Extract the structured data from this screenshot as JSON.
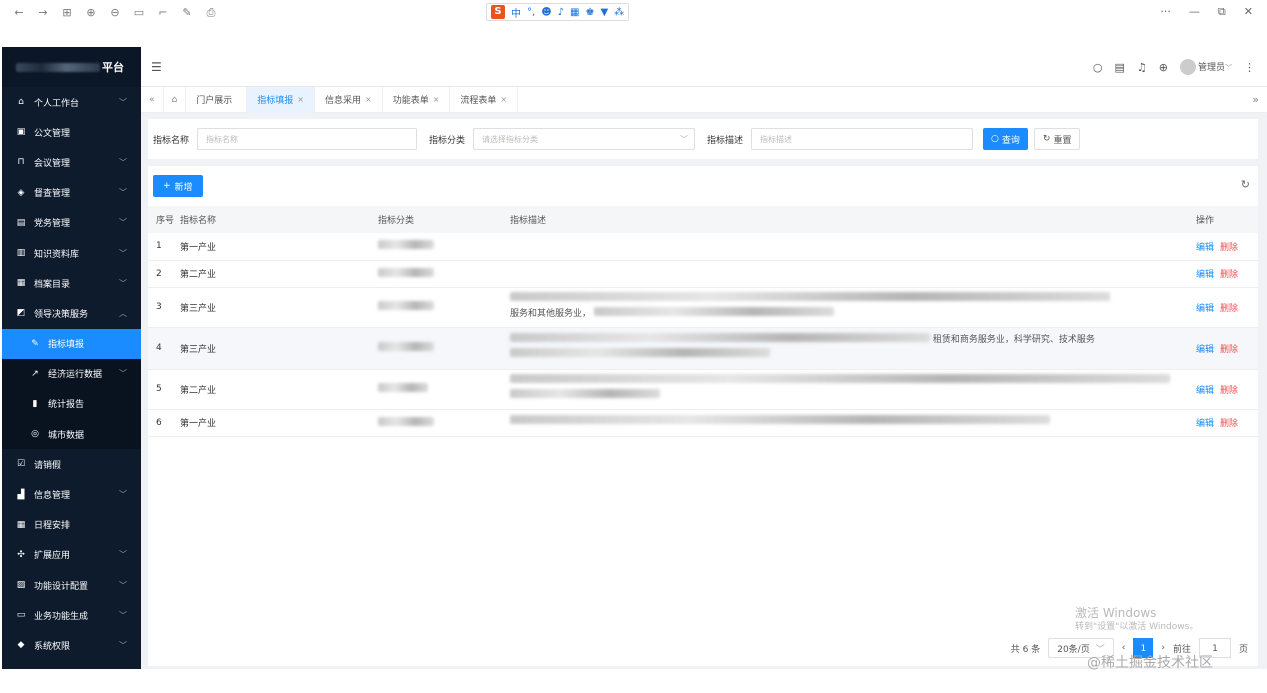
{
  "ime": {
    "logo": "S",
    "lang": "中",
    "items": [
      "°,",
      "☻",
      "♪",
      "▦",
      "♚",
      "▼",
      "⁂"
    ]
  },
  "app": {
    "name": "平台"
  },
  "sidebar": {
    "items": [
      {
        "label": "个人工作台",
        "icon": "home-icon",
        "glyph": "⌂",
        "arrow": "﹀"
      },
      {
        "label": "公文管理",
        "icon": "document-icon",
        "glyph": "▣",
        "arrow": ""
      },
      {
        "label": "会议管理",
        "icon": "meeting-icon",
        "glyph": "⊓",
        "arrow": "﹀"
      },
      {
        "label": "督查管理",
        "icon": "shield-check-icon",
        "glyph": "◈",
        "arrow": "﹀"
      },
      {
        "label": "党务管理",
        "icon": "badge-icon",
        "glyph": "▤",
        "arrow": "﹀"
      },
      {
        "label": "知识资料库",
        "icon": "book-icon",
        "glyph": "▥",
        "arrow": "﹀"
      },
      {
        "label": "档案目录",
        "icon": "archive-icon",
        "glyph": "▦",
        "arrow": "﹀"
      },
      {
        "label": "领导决策服务",
        "icon": "chart-box-icon",
        "glyph": "◩",
        "arrow": "︿"
      },
      {
        "label": "指标填报",
        "icon": "edit-icon",
        "glyph": "✎",
        "arrow": "",
        "sub": true,
        "active": true
      },
      {
        "label": "经济运行数据",
        "icon": "line-chart-icon",
        "glyph": "↗",
        "arrow": "﹀",
        "sub": true
      },
      {
        "label": "统计报告",
        "icon": "report-icon",
        "glyph": "▮",
        "arrow": "",
        "sub": true
      },
      {
        "label": "城市数据",
        "icon": "globe-icon",
        "glyph": "◎",
        "arrow": "",
        "sub": true
      },
      {
        "label": "请销假",
        "icon": "checklist-icon",
        "glyph": "☑",
        "arrow": ""
      },
      {
        "label": "信息管理",
        "icon": "bar-chart-icon",
        "glyph": "▟",
        "arrow": "﹀"
      },
      {
        "label": "日程安排",
        "icon": "calendar-icon",
        "glyph": "▦",
        "arrow": ""
      },
      {
        "label": "扩展应用",
        "icon": "apps-icon",
        "glyph": "✣",
        "arrow": "﹀"
      },
      {
        "label": "功能设计配置",
        "icon": "config-icon",
        "glyph": "▨",
        "arrow": "﹀"
      },
      {
        "label": "业务功能生成",
        "icon": "code-icon",
        "glyph": "▭",
        "arrow": "﹀"
      },
      {
        "label": "系统权限",
        "icon": "lock-shield-icon",
        "glyph": "◆",
        "arrow": "﹀"
      }
    ]
  },
  "header": {
    "user": "管理员",
    "caret": "﹀"
  },
  "tabs": [
    {
      "label": "门户展示",
      "close": ""
    },
    {
      "label": "指标填报",
      "close": "×",
      "active": true
    },
    {
      "label": "信息采用",
      "close": "×"
    },
    {
      "label": "功能表单",
      "close": "×"
    },
    {
      "label": "流程表单",
      "close": "×"
    }
  ],
  "search": {
    "name_label": "指标名称",
    "name_placeholder": "指标名称",
    "category_label": "指标分类",
    "category_placeholder": "请选择指标分类",
    "desc_label": "指标描述",
    "desc_placeholder": "指标描述",
    "query_label": "查询",
    "reset_label": "重置"
  },
  "table": {
    "add_label": "新增",
    "columns": {
      "seq": "序号",
      "name": "指标名称",
      "category": "指标分类",
      "desc": "指标描述",
      "ops": "操作"
    },
    "edit_label": "编辑",
    "delete_label": "删除",
    "rows": [
      {
        "seq": "1",
        "name": "第一产业",
        "desc_text": ""
      },
      {
        "seq": "2",
        "name": "第二产业",
        "desc_text": ""
      },
      {
        "seq": "3",
        "name": "第三产业",
        "desc_text": "服务和其他服务业，"
      },
      {
        "seq": "4",
        "name": "第三产业",
        "desc_text": "租赁和商务服务业，科学研究、技术服务"
      },
      {
        "seq": "5",
        "name": "第二产业",
        "desc_text": ""
      },
      {
        "seq": "6",
        "name": "第一产业",
        "desc_text": ""
      }
    ]
  },
  "pager": {
    "total": "共 6 条",
    "size": "20条/页",
    "page": "1",
    "goto": "前往",
    "goto_value": "1",
    "unit": "页"
  },
  "watermark": {
    "line1": "激活 Windows",
    "line2": "转到\"设置\"以激活 Windows。",
    "site": "@稀土掘金技术社区"
  }
}
